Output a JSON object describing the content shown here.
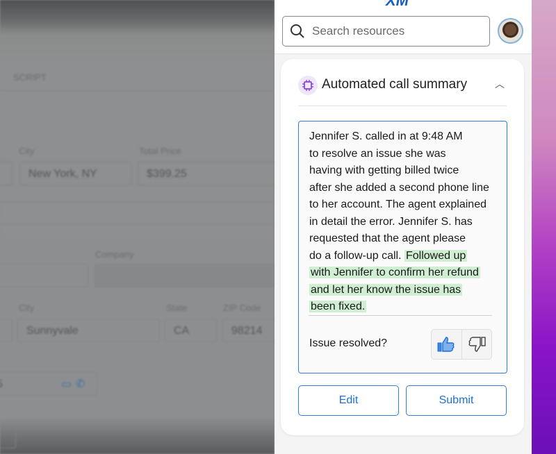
{
  "background_form": {
    "tab_label": "SCRIPT",
    "fields": [
      {
        "label": "",
        "value": ""
      },
      {
        "label": "City",
        "value": "New York, NY"
      },
      {
        "label": "Total Price",
        "value": "$399.25"
      },
      {
        "label": "",
        "value": ""
      },
      {
        "label": "Company",
        "value": ""
      },
      {
        "label": "",
        "value": ""
      },
      {
        "label": "City",
        "value": "Sunnyvale"
      },
      {
        "label": "State",
        "value": "CA"
      },
      {
        "label": "ZIP Code",
        "value": "98214"
      },
      {
        "label": "",
        "value": "5"
      }
    ]
  },
  "panel": {
    "logo": "XM",
    "search": {
      "placeholder": "Search resources",
      "value": ""
    },
    "card": {
      "title": "Automated call summary",
      "icon": "ai-chip-icon",
      "summary_lines": [
        "Jennifer S. called in at 9:48 AM",
        "to resolve an issue she was",
        "having with getting billed twice",
        "after she added a second phone line",
        "to her account. The agent explained",
        "in detail the error. Jennifer S. has",
        "requested that the agent please",
        "do a follow-up call."
      ],
      "highlighted_lines": [
        "Followed up",
        "with Jennifer to confirm her refund",
        "and let her know the issue has",
        "been fixed."
      ],
      "question": "Issue resolved?",
      "feedback_selected": "thumbs-up",
      "edit_label": "Edit",
      "submit_label": "Submit"
    }
  },
  "colors": {
    "accent": "#2f7de0",
    "highlight": "#cfeed2",
    "ai_chip": "#7b2fd6"
  }
}
